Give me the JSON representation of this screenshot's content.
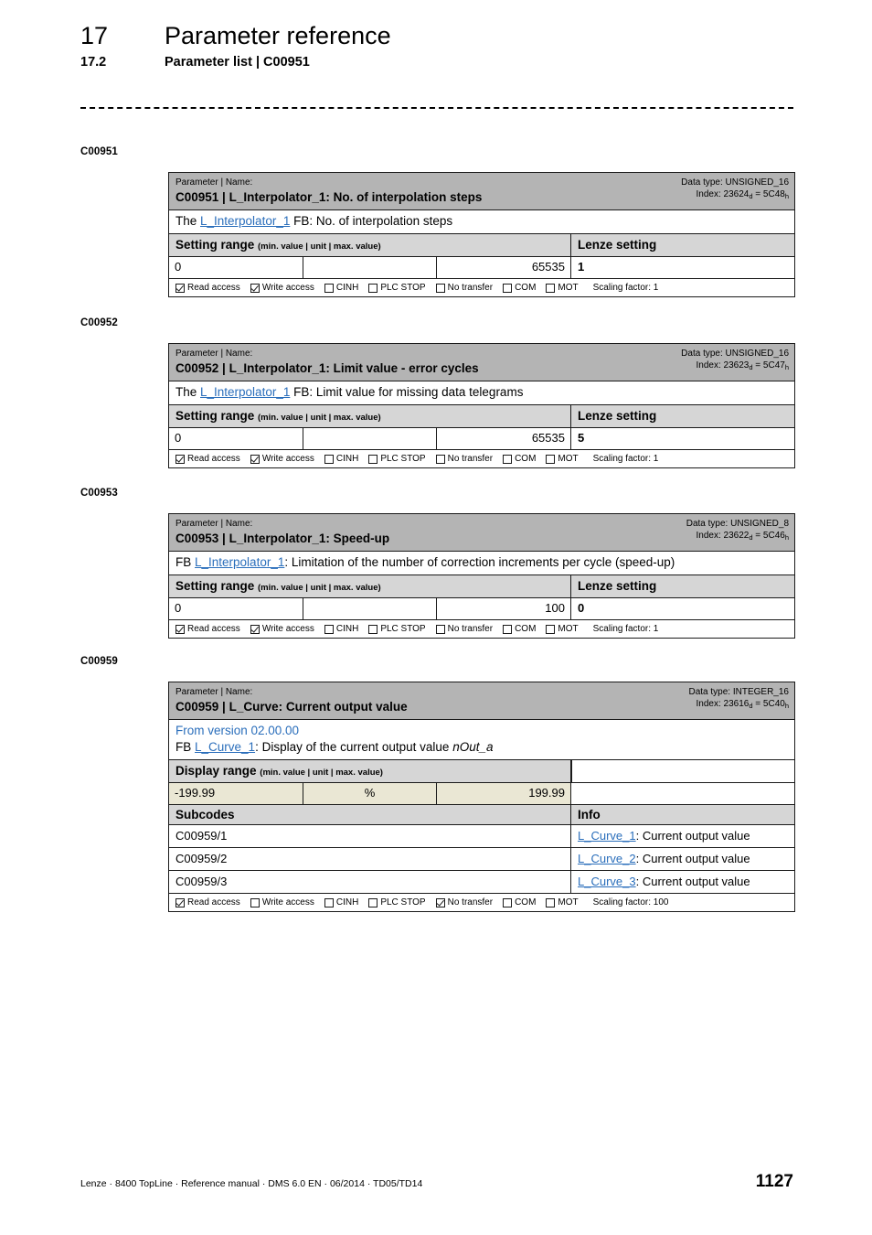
{
  "header": {
    "chapter_number": "17",
    "chapter_title": "Parameter reference",
    "section_number": "17.2",
    "section_title": "Parameter list | C00951"
  },
  "footer": {
    "text": "Lenze · 8400 TopLine · Reference manual · DMS 6.0 EN · 06/2014 · TD05/TD14",
    "page_number": "1127"
  },
  "labels": {
    "parameter_name_caption": "Parameter | Name:",
    "data_type_prefix": "Data type: ",
    "index_prefix": "Index: ",
    "setting_range_title": "Setting range",
    "display_range_title": "Display range",
    "range_subtitle": "(min. value | unit | max. value)",
    "lenze_setting_title": "Lenze setting",
    "subcodes_title": "Subcodes",
    "info_title": "Info",
    "flag_read": "Read access",
    "flag_write": "Write access",
    "flag_cinh": "CINH",
    "flag_plcstop": "PLC STOP",
    "flag_notransfer": "No transfer",
    "flag_com": "COM",
    "flag_mot": "MOT",
    "scaling_prefix": "Scaling factor: "
  },
  "colors": {
    "header_band": "#b4b4b4",
    "subheader_band": "#d6d6d6",
    "range_beige": "#eae7d4",
    "link_blue": "#2a6ebb",
    "border": "#1a1a1a"
  },
  "blocks": [
    {
      "code": "C00951",
      "title": "C00951 | L_Interpolator_1: No. of interpolation steps",
      "data_type": "UNSIGNED_16",
      "index_dec": "23624",
      "index_hex": "5C48",
      "desc_prefix": "The ",
      "desc_link": "L_Interpolator_1",
      "desc_suffix": " FB: No. of interpolation steps",
      "range_kind": "setting",
      "min": "0",
      "unit": "",
      "max": "65535",
      "lenze": "1",
      "flags": {
        "read": true,
        "write": true,
        "cinh": false,
        "plcstop": false,
        "notransfer": false,
        "com": false,
        "mot": false
      },
      "scaling": "1"
    },
    {
      "code": "C00952",
      "title": "C00952 | L_Interpolator_1: Limit value - error cycles",
      "data_type": "UNSIGNED_16",
      "index_dec": "23623",
      "index_hex": "5C47",
      "desc_prefix": "The ",
      "desc_link": "L_Interpolator_1",
      "desc_suffix": " FB: Limit value for missing data telegrams",
      "range_kind": "setting",
      "min": "0",
      "unit": "",
      "max": "65535",
      "lenze": "5",
      "flags": {
        "read": true,
        "write": true,
        "cinh": false,
        "plcstop": false,
        "notransfer": false,
        "com": false,
        "mot": false
      },
      "scaling": "1"
    },
    {
      "code": "C00953",
      "title": "C00953 | L_Interpolator_1: Speed-up",
      "data_type": "UNSIGNED_8",
      "index_dec": "23622",
      "index_hex": "5C46",
      "desc_prefix": "FB ",
      "desc_link": "L_Interpolator_1",
      "desc_suffix": ": Limitation of the number of correction increments per cycle (speed-up)",
      "range_kind": "setting",
      "min": "0",
      "unit": "",
      "max": "100",
      "lenze": "0",
      "flags": {
        "read": true,
        "write": true,
        "cinh": false,
        "plcstop": false,
        "notransfer": false,
        "com": false,
        "mot": false
      },
      "scaling": "1"
    },
    {
      "code": "C00959",
      "title": "C00959 | L_Curve: Current output value",
      "data_type": "INTEGER_16",
      "index_dec": "23616",
      "index_hex": "5C40",
      "version_line": "From version 02.00.00",
      "desc_prefix": "FB ",
      "desc_link": "L_Curve_1",
      "desc_suffix": ": Display of the current output value ",
      "desc_italic": "nOut_a",
      "range_kind": "display",
      "min": "-199.99",
      "unit": "%",
      "max": "199.99",
      "lenze": "",
      "subcodes": [
        {
          "code": "C00959/1",
          "info_link": "L_Curve_1",
          "info_text": ": Current output value"
        },
        {
          "code": "C00959/2",
          "info_link": "L_Curve_2",
          "info_text": ": Current output value"
        },
        {
          "code": "C00959/3",
          "info_link": "L_Curve_3",
          "info_text": ": Current output value"
        }
      ],
      "flags": {
        "read": true,
        "write": false,
        "cinh": false,
        "plcstop": false,
        "notransfer": true,
        "com": false,
        "mot": false
      },
      "scaling": "100"
    }
  ]
}
